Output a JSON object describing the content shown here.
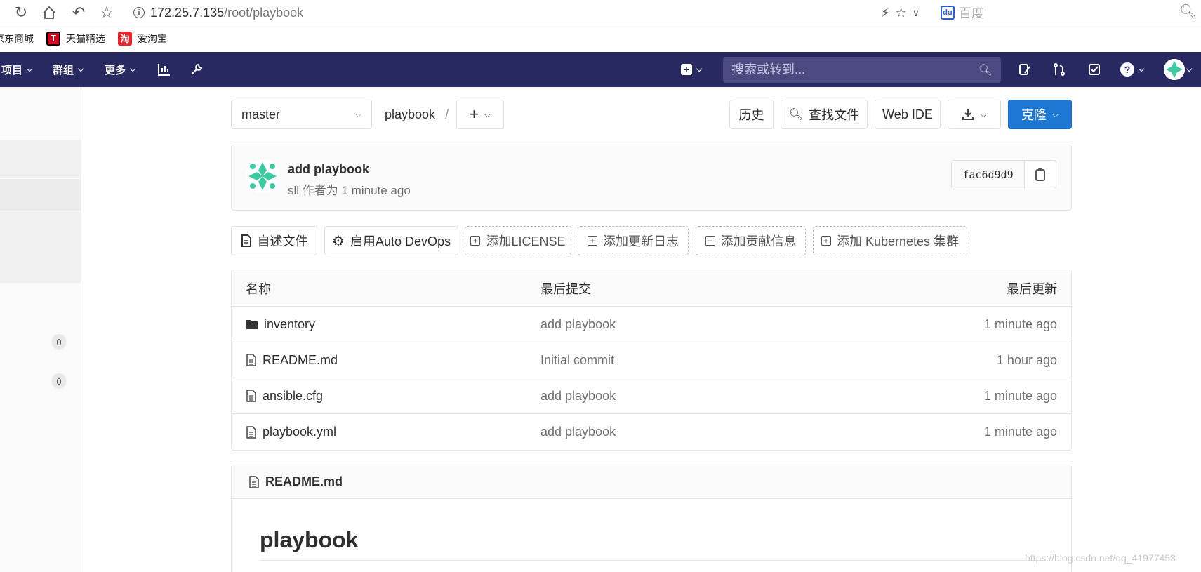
{
  "browser": {
    "url_host": "172.25.7.135",
    "url_path": "/root/playbook",
    "search_engine": "百度"
  },
  "bookmarks": [
    {
      "label": "京东商城",
      "icon": "jd-icon"
    },
    {
      "label": "天猫精选",
      "icon": "tmall-icon",
      "icon_char": "T",
      "color": "#d4041c"
    },
    {
      "label": "爱淘宝",
      "icon": "taobao-icon",
      "icon_char": "淘",
      "color": "#e8232c"
    }
  ],
  "navbar": {
    "projects": "项目",
    "groups": "群组",
    "more": "更多",
    "search_placeholder": "搜索或转到...",
    "bg_color": "#292961"
  },
  "sidebar": {
    "badge1": "0",
    "badge2": "0"
  },
  "toolbar": {
    "branch": "master",
    "repo": "playbook",
    "separator": "/",
    "history": "历史",
    "find_file": "查找文件",
    "web_ide": "Web IDE",
    "clone": "克隆"
  },
  "commit": {
    "title": "add playbook",
    "meta": "sll 作者为 1 minute ago",
    "sha": "fac6d9d9"
  },
  "actions": {
    "readme": "自述文件",
    "auto_devops": "启用Auto DevOps",
    "add_license": "添加LICENSE",
    "add_changelog": "添加更新日志",
    "add_contributing": "添加贡献信息",
    "add_k8s": "添加 Kubernetes 集群"
  },
  "file_table": {
    "headers": {
      "name": "名称",
      "last_commit": "最后提交",
      "last_update": "最后更新"
    },
    "rows": [
      {
        "name": "inventory",
        "type": "folder",
        "commit": "add playbook",
        "time": "1 minute ago"
      },
      {
        "name": "README.md",
        "type": "file",
        "commit": "Initial commit",
        "time": "1 hour ago"
      },
      {
        "name": "ansible.cfg",
        "type": "file",
        "commit": "add playbook",
        "time": "1 minute ago"
      },
      {
        "name": "playbook.yml",
        "type": "file",
        "commit": "add playbook",
        "time": "1 minute ago"
      }
    ]
  },
  "readme": {
    "filename": "README.md",
    "heading": "playbook"
  },
  "watermark": "https://blog.csdn.net/qq_41977453"
}
